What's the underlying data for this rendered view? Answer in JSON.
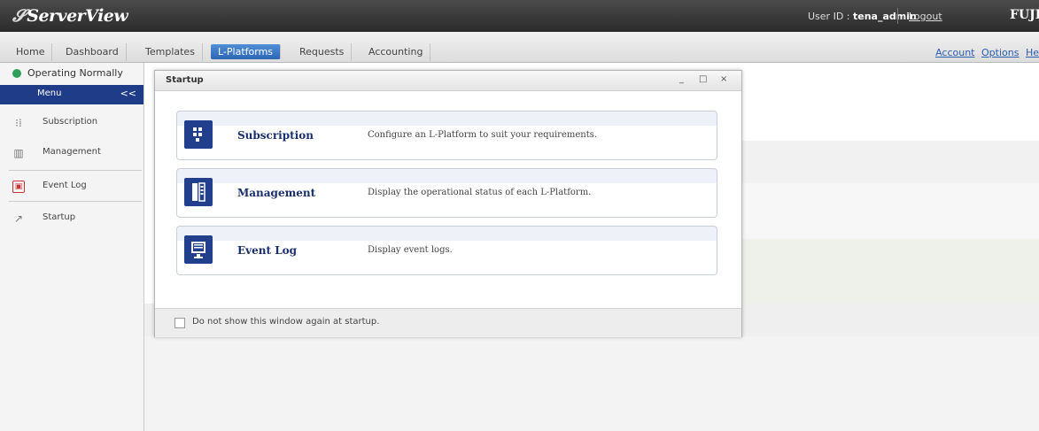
{
  "header": {
    "logo": "ServerView",
    "userid_label": "User ID : ",
    "userid_value": "tena_admin",
    "logout": "Logout",
    "brand": "FUJITS"
  },
  "nav": {
    "tabs": [
      "Home",
      "Dashboard",
      "Templates",
      "L-Platforms",
      "Requests",
      "Accounting"
    ],
    "active": "L-Platforms",
    "links": [
      "Account",
      "Options",
      "He"
    ]
  },
  "sidebar": {
    "status": "Operating Normally",
    "menu_title": "Menu",
    "collapse": "<<",
    "items": [
      {
        "label": "Subscription",
        "icon": "subscription-icon"
      },
      {
        "label": "Management",
        "icon": "management-icon"
      },
      {
        "label": "Event Log",
        "icon": "event-log-icon"
      },
      {
        "label": "Startup",
        "icon": "startup-icon"
      }
    ]
  },
  "dialog": {
    "title": "Startup",
    "controls": [
      "_",
      "□",
      "×"
    ],
    "options": [
      {
        "name": "Subscription",
        "desc": "Configure an L-Platform to suit your requirements.",
        "icon": "subscription-icon"
      },
      {
        "name": "Management",
        "desc": "Display the operational status of each L-Platform.",
        "icon": "management-icon"
      },
      {
        "name": "Event Log",
        "desc": "Display event logs.",
        "icon": "event-log-icon"
      }
    ],
    "checkbox_label": "Do not show this window again at startup."
  },
  "colors": {
    "header_bg": "#333333",
    "accent": "#1f3c88",
    "active_tab": "#2c66b5",
    "status_ok": "#2f9e5a"
  }
}
